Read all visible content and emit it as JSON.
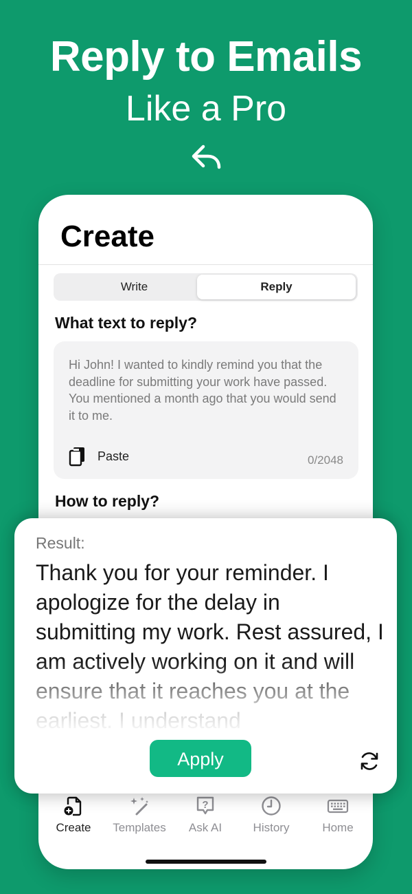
{
  "hero": {
    "title": "Reply to Emails",
    "subtitle": "Like a Pro",
    "icon": "reply-arrow-icon"
  },
  "screen": {
    "title": "Create",
    "segments": {
      "write": "Write",
      "reply": "Reply",
      "selected": "Reply"
    },
    "question_text": "What text to reply?",
    "input": {
      "value": "Hi John! I wanted to kindly remind you that the deadline for submitting your work have passed. You mentioned a month ago that you would send it to me.",
      "paste_label": "Paste",
      "char_count": "0/2048"
    },
    "question_how": "How to reply?"
  },
  "result": {
    "label": "Result:",
    "text": "Thank you for your reminder. I apologize for the delay in submitting my work. Rest assured, I am actively working on it and will ensure that it reaches you at the earliest. I understand",
    "apply_label": "Apply"
  },
  "nav": {
    "items": [
      {
        "label": "Create",
        "icon": "create-doc-icon",
        "active": true
      },
      {
        "label": "Templates",
        "icon": "sparkles-icon",
        "active": false
      },
      {
        "label": "Ask AI",
        "icon": "question-bubble-icon",
        "active": false
      },
      {
        "label": "History",
        "icon": "clock-icon",
        "active": false
      },
      {
        "label": "Home",
        "icon": "keyboard-icon",
        "active": false
      }
    ]
  },
  "colors": {
    "background": "#0e9a6c",
    "accent": "#12b985",
    "card": "#ffffff",
    "input_bg": "#f3f3f4"
  }
}
